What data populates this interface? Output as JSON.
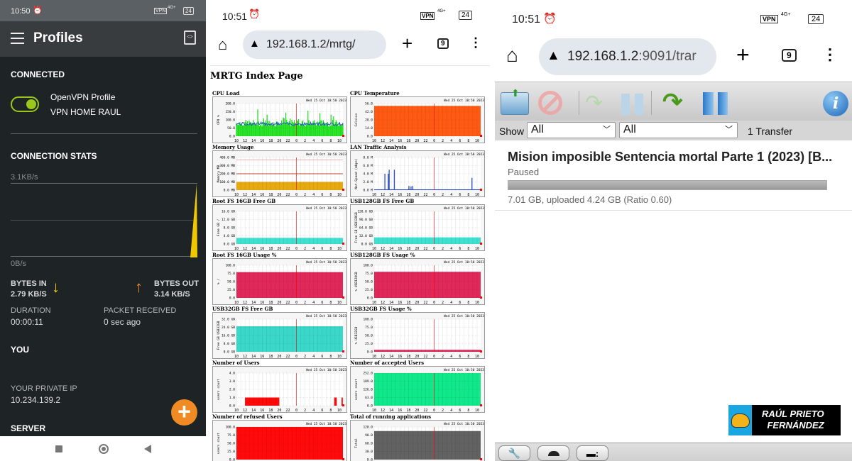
{
  "left_phone": {
    "status_time": "10:50",
    "status_vpn": "VPN",
    "status_network": "4G+",
    "battery": "24",
    "header_title": "Profiles",
    "connected_heading": "CONNECTED",
    "profile_name": "OpenVPN Profile",
    "profile_server": "VPN HOME RAUL",
    "toggle_on": true,
    "accent": "#9bc61a",
    "stats_heading": "CONNECTION STATS",
    "graph_max": "3.1KB/s",
    "graph_min": "0B/s",
    "bytes_in_label": "BYTES IN",
    "bytes_in_value": "2.79 KB/S",
    "bytes_out_label": "BYTES OUT",
    "bytes_out_value": "3.14 KB/S",
    "duration_label": "DURATION",
    "duration_value": "00:00:11",
    "packet_label": "PACKET RECEIVED",
    "packet_value": "0 sec ago",
    "you_heading": "YOU",
    "private_ip_label": "YOUR PRIVATE IP",
    "private_ip_value": "10.234.139.2",
    "server_heading": "SERVER",
    "fab_color": "#f08a24"
  },
  "mid_phone": {
    "status_time": "10:51",
    "status_vpn": "VPN",
    "status_network": "4G+",
    "battery": "24",
    "url": "192.168.1.2/mrtg/",
    "tab_count": "9",
    "page_title": "MRTG Index Page",
    "timestamp": "Wed 25 Oct 10:50 2023",
    "x_labels": [
      "10",
      "12",
      "14",
      "16",
      "18",
      "20",
      "22",
      "0",
      "2",
      "4",
      "6",
      "8",
      "10"
    ],
    "graphs": [
      {
        "title": "CPU Load",
        "ylabel": "CPU %",
        "yticks": [
          "0.0",
          "50.0",
          "100.0",
          "150.0",
          "200.0"
        ],
        "ymax": 200,
        "color": "#19e019",
        "kind": "noisy",
        "level": 75,
        "line_color": "#2a4fd0"
      },
      {
        "title": "CPU Temperature",
        "ylabel": "Celsius",
        "yticks": [
          "0.0",
          "14.0",
          "28.0",
          "42.0",
          "56.0"
        ],
        "ymax": 56,
        "color": "#ff5a14",
        "kind": "level",
        "level": 52
      },
      {
        "title": "Memory Usage",
        "ylabel": "Memory MB",
        "yticks": [
          "0.0 MB",
          "100.0 MB",
          "200.0 MB",
          "300.0 MB",
          "400.0 MB"
        ],
        "ymax": 400,
        "color": "#e6aa10",
        "kind": "level",
        "level": 100,
        "lines": [
          {
            "value": 200,
            "color": "#c84a2a"
          },
          {
            "value": 370,
            "color": "#f0b0b0"
          }
        ]
      },
      {
        "title": "LAN Traffic Analysis",
        "ylabel": "Net.Speed (mbps)",
        "yticks": [
          "0.0 M",
          "2.0 M",
          "4.0 M",
          "6.0 M",
          "8.0 M"
        ],
        "ymax": 8,
        "color": "#2a4fd0",
        "kind": "spikes",
        "spikes": [
          [
            12.5,
            4
          ],
          [
            13.3,
            4
          ],
          [
            13.5,
            5
          ],
          [
            14.7,
            5
          ],
          [
            18.1,
            1
          ],
          [
            18.6,
            0.9
          ],
          [
            19,
            1
          ],
          [
            32.8,
            3
          ]
        ]
      },
      {
        "title": "Root FS 16GB Free GB",
        "ylabel": "Free GB /",
        "yticks": [
          "0.0 GB",
          "4.0 GB",
          "8.0 GB",
          "12.0 GB",
          "16.0 GB"
        ],
        "ymax": 16,
        "color": "#3ee0d0",
        "kind": "level",
        "level": 3
      },
      {
        "title": "USB128GB FS Free GB",
        "ylabel": "Free GB USB128GB",
        "yticks": [
          "0.0 GB",
          "32.0 GB",
          "64.0 GB",
          "96.0 GB",
          "128.0 GB"
        ],
        "ymax": 128,
        "color": "#3ee0d0",
        "kind": "level",
        "level": 26
      },
      {
        "title": "Root FS 16GB Usage %",
        "ylabel": "% /",
        "yticks": [
          "0.0",
          "25.0",
          "50.0",
          "75.0",
          "100.0"
        ],
        "ymax": 100,
        "color": "#e0285a",
        "kind": "level",
        "level": 79
      },
      {
        "title": "USB128GB FS Usage %",
        "ylabel": "% USB128GB",
        "yticks": [
          "0.0",
          "25.0",
          "50.0",
          "75.0",
          "100.0"
        ],
        "ymax": 100,
        "color": "#e0285a",
        "kind": "level",
        "level": 80
      },
      {
        "title": "USB32GB FS Free GB",
        "ylabel": "Free GB USB32GB",
        "yticks": [
          "0.0 GB",
          "8.0 GB",
          "16.0 GB",
          "24.0 GB",
          "32.0 GB"
        ],
        "ymax": 32,
        "color": "#3ad8c8",
        "kind": "level",
        "level": 25
      },
      {
        "title": "USB32GB FS Usage %",
        "ylabel": "% USB32GB",
        "yticks": [
          "0.0",
          "25.0",
          "50.0",
          "75.0",
          "100.0"
        ],
        "ymax": 100,
        "color": "#e0285a",
        "kind": "level",
        "level": 6
      },
      {
        "title": "Number of Users",
        "ylabel": "users count",
        "yticks": [
          "0.0",
          "1.0",
          "2.0",
          "3.0",
          "4.0"
        ],
        "ymax": 4,
        "color": "#ff0a0a",
        "kind": "segments",
        "segments": [
          [
            12,
            20,
            1
          ],
          [
            32.8,
            33.4,
            1
          ],
          [
            34.5,
            34.8,
            1
          ]
        ]
      },
      {
        "title": "Number of accepted Users",
        "ylabel": "users count",
        "yticks": [
          "0.0",
          "63.0",
          "126.0",
          "189.0",
          "252.0"
        ],
        "ymax": 252,
        "color": "#10e88a",
        "kind": "level",
        "level": 252
      },
      {
        "title": "Number of refused Users",
        "ylabel": "users count",
        "yticks": [
          "0.0",
          "25.0",
          "50.0",
          "75.0",
          "100.0"
        ],
        "ymax": 100,
        "color": "#ff0a0a",
        "kind": "level",
        "level": 100
      },
      {
        "title": "Total of running applications",
        "ylabel": "Total",
        "yticks": [
          "0.0",
          "30.0",
          "60.0",
          "90.0",
          "120.0"
        ],
        "ymax": 120,
        "color": "#626262",
        "kind": "level",
        "level": 105
      }
    ]
  },
  "right_phone": {
    "status_time": "10:51",
    "status_vpn": "VPN",
    "status_network": "4G+",
    "battery": "24",
    "url_host": "192.168.1.2",
    "url_rest": ":9091/trar",
    "tab_count": "9",
    "show_label": "Show",
    "filter1": "All",
    "filter2": "All",
    "transfer_count": "1 Transfer",
    "torrent": {
      "name": "Mision imposible Sentencia mortal Parte 1 (2023) [B...",
      "status": "Paused",
      "progress_percent": 100,
      "stats": "7.01 GB, uploaded 4.24 GB (Ratio 0.60)"
    },
    "watermark": {
      "line1": "RAÚL PRIETO",
      "line2": "FERNÁNDEZ"
    }
  }
}
